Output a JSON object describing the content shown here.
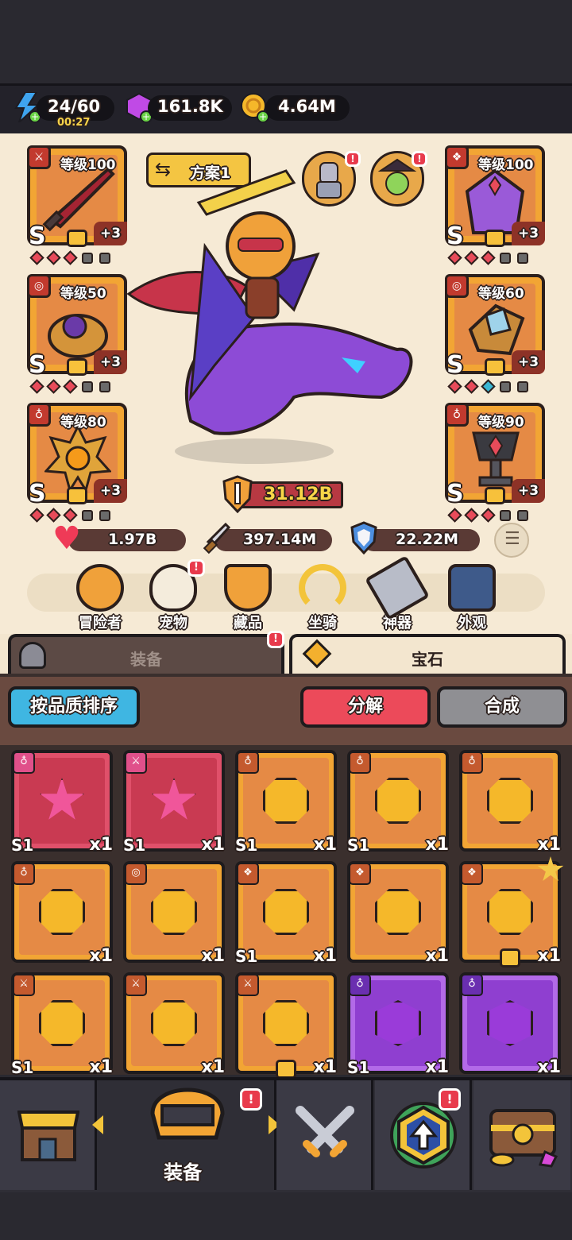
{
  "resources": {
    "energy": "24/60",
    "energy_timer": "00:27",
    "gems": "161.8K",
    "gold": "4.64M"
  },
  "loadout": {
    "label": "方案1"
  },
  "equipment_slots": [
    {
      "id": "weapon",
      "level": "等级100",
      "grade": "S",
      "bonus": "+3",
      "tag_icon": "sword-icon"
    },
    {
      "id": "armor",
      "level": "等级100",
      "grade": "S",
      "bonus": "+3",
      "tag_icon": "armor-icon"
    },
    {
      "id": "ring",
      "level": "等级50",
      "grade": "S",
      "bonus": "+3",
      "tag_icon": "ring-icon"
    },
    {
      "id": "bracer",
      "level": "等级60",
      "grade": "S",
      "bonus": "+3",
      "tag_icon": "ring-icon"
    },
    {
      "id": "necklace",
      "level": "等级80",
      "grade": "S",
      "bonus": "+3",
      "tag_icon": "necklace-icon"
    },
    {
      "id": "trophy",
      "level": "等级90",
      "grade": "S",
      "bonus": "+3",
      "tag_icon": "necklace-icon"
    }
  ],
  "power": "31.12B",
  "stats": {
    "hp": "1.97B",
    "attack": "397.14M",
    "defense": "22.22M"
  },
  "menu": [
    "冒险者",
    "宠物",
    "藏品",
    "坐骑",
    "神器",
    "外观"
  ],
  "tabs": {
    "equipment": "装备",
    "gems": "宝石"
  },
  "buttons": {
    "sort": "按品质排序",
    "decompose": "分解",
    "synthesize": "合成"
  },
  "inventory": [
    {
      "kind": "star",
      "color": "pink",
      "tier": "S1",
      "qty": "x1",
      "tag": "necklace"
    },
    {
      "kind": "star",
      "color": "pink",
      "tier": "S1",
      "qty": "x1",
      "tag": "sword"
    },
    {
      "kind": "oct",
      "color": "gold",
      "tier": "S1",
      "qty": "x1",
      "tag": "necklace"
    },
    {
      "kind": "oct",
      "color": "gold",
      "tier": "S1",
      "qty": "x1",
      "tag": "necklace"
    },
    {
      "kind": "oct",
      "color": "gold",
      "tier": "",
      "qty": "x1",
      "tag": "necklace"
    },
    {
      "kind": "oct",
      "color": "gold",
      "tier": "",
      "qty": "x1",
      "tag": "necklace"
    },
    {
      "kind": "oct",
      "color": "gold",
      "tier": "",
      "qty": "x1",
      "tag": "ring"
    },
    {
      "kind": "oct",
      "color": "gold",
      "tier": "S1",
      "qty": "x1",
      "tag": "armor"
    },
    {
      "kind": "oct",
      "color": "gold",
      "tier": "",
      "qty": "x1",
      "tag": "armor"
    },
    {
      "kind": "oct",
      "color": "gold",
      "tier": "",
      "qty": "x1",
      "tag": "armor",
      "locked": true,
      "starred": true
    },
    {
      "kind": "oct",
      "color": "gold",
      "tier": "S1",
      "qty": "x1",
      "tag": "sword"
    },
    {
      "kind": "oct",
      "color": "gold",
      "tier": "",
      "qty": "x1",
      "tag": "sword"
    },
    {
      "kind": "oct",
      "color": "gold",
      "tier": "",
      "qty": "x1",
      "tag": "sword",
      "locked": true
    },
    {
      "kind": "hex",
      "color": "purple",
      "tier": "S1",
      "qty": "x1",
      "tag": "necklace"
    },
    {
      "kind": "hex",
      "color": "purple",
      "tier": "",
      "qty": "x1",
      "tag": "necklace"
    }
  ],
  "nav": {
    "active_label": "装备"
  },
  "colors": {
    "gold_gem": "#f5b82a",
    "pink_gem": "#f0569a",
    "purple_gem": "#9a3bd9",
    "card_orange": "#e58a45",
    "card_red": "#c93a52",
    "card_purple": "#8f3fd0"
  }
}
